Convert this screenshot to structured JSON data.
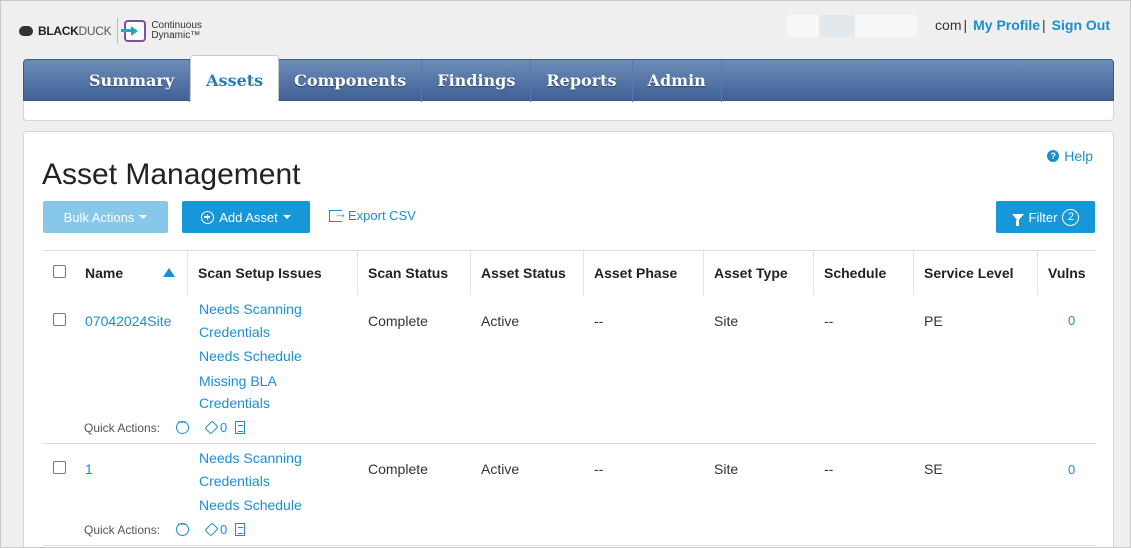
{
  "header": {
    "logo_black": "BLACK",
    "logo_duck": "DUCK",
    "product_line1": "Continuous",
    "product_line2": "Dynamic™",
    "account_suffix": "com",
    "my_profile": "My Profile",
    "sign_out": "Sign Out"
  },
  "nav": {
    "tabs": [
      {
        "label": "Summary",
        "active": false
      },
      {
        "label": "Assets",
        "active": true
      },
      {
        "label": "Components",
        "active": false
      },
      {
        "label": "Findings",
        "active": false
      },
      {
        "label": "Reports",
        "active": false
      },
      {
        "label": "Admin",
        "active": false
      }
    ]
  },
  "page": {
    "title": "Asset Management",
    "help": "Help",
    "bulk_actions": "Bulk Actions",
    "add_asset": "Add Asset",
    "export_csv": "Export CSV",
    "filter": "Filter",
    "filter_count": "2"
  },
  "table": {
    "columns": [
      "Name",
      "Scan Setup Issues",
      "Scan Status",
      "Asset Status",
      "Asset Phase",
      "Asset Type",
      "Schedule",
      "Service Level",
      "Vulns"
    ],
    "sort_column": "Name",
    "sort_direction": "ascending",
    "quick_actions_label": "Quick Actions:",
    "rows": [
      {
        "name": "07042024Site",
        "issues": [
          "Needs Scanning",
          "Credentials",
          "Needs Schedule",
          "Missing BLA",
          "Credentials"
        ],
        "scan_status": "Complete",
        "asset_status": "Active",
        "asset_phase": "--",
        "asset_type": "Site",
        "schedule": "--",
        "service_level": "PE",
        "vulns": "0",
        "tag_count": "0"
      },
      {
        "name": "1",
        "issues": [
          "Needs Scanning",
          "Credentials",
          "Needs Schedule"
        ],
        "scan_status": "Complete",
        "asset_status": "Active",
        "asset_phase": "--",
        "asset_type": "Site",
        "schedule": "--",
        "service_level": "SE",
        "vulns": "0",
        "tag_count": "0"
      }
    ]
  },
  "colors": {
    "accent": "#1a8fd0",
    "nav_top": "#6d8db9",
    "nav_bottom": "#3f6194",
    "button_primary": "#1597d8",
    "button_disabled": "#87c8ea"
  }
}
